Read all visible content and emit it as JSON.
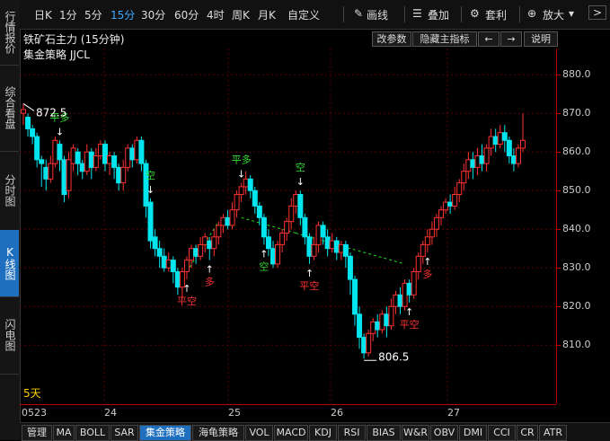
{
  "sidebar": {
    "tabs": [
      {
        "label": "行情报价",
        "active": false
      },
      {
        "label": "综合看盘",
        "active": false
      },
      {
        "label": "分时图",
        "active": false
      },
      {
        "label": "K线图",
        "active": true
      },
      {
        "label": "闪电图",
        "active": false
      }
    ]
  },
  "toolbar": {
    "periods": [
      "日K",
      "1分",
      "5分",
      "15分",
      "30分",
      "60分",
      "4时",
      "周K",
      "月K",
      "自定义"
    ],
    "active_period": "15分",
    "draw_label": "画线",
    "overlay_label": "叠加",
    "arbitrage_label": "套利",
    "zoom_label": "放大",
    "next_label": ">"
  },
  "header": {
    "title": "铁矿石主力 (15分钟)",
    "strategy": "集金策略 JJCL",
    "buttons": [
      "改参数",
      "隐藏主指标",
      "←",
      "→",
      "说明"
    ]
  },
  "price_axis": {
    "ticks": [
      "880.0",
      "870.0",
      "860.0",
      "850.0",
      "840.0",
      "830.0",
      "820.0",
      "810.0"
    ]
  },
  "x_axis": {
    "ticks": [
      "0523",
      "24",
      "25",
      "26",
      "27"
    ]
  },
  "chart_labels": {
    "period_count": "5天",
    "high_label": "872.5",
    "low_label": "806.5"
  },
  "colors": {
    "up": "#ff3030",
    "down": "#00e5ee",
    "signal_green": "#33dd33",
    "signal_red": "#ff3333",
    "dash": "#22dd22"
  },
  "bottom_tabs": [
    "管理",
    "MA",
    "BOLL",
    "SAR",
    "集金策略",
    "海龟策略",
    "VOL",
    "MACD",
    "KDJ",
    "RSI",
    "BIAS",
    "W&R",
    "OBV",
    "DMI",
    "CCI",
    "CR",
    "ATR"
  ],
  "active_bottom_tab": "集金策略",
  "chart_data": {
    "type": "candlestick",
    "title": "铁矿石主力 (15分钟)",
    "ylim": [
      804,
      884
    ],
    "yticks": [
      880,
      870,
      860,
      850,
      840,
      830,
      820,
      810
    ],
    "xticks": [
      "0523",
      "24",
      "25",
      "26",
      "27"
    ],
    "high": 872.5,
    "low": 806.5,
    "candles": [
      [
        870,
        871,
        872.5,
        867
      ],
      [
        869,
        866,
        870,
        864
      ],
      [
        866,
        864,
        867,
        862
      ],
      [
        864,
        858,
        865,
        856
      ],
      [
        858,
        857,
        859,
        851
      ],
      [
        856,
        853,
        858,
        850
      ],
      [
        853,
        857,
        859,
        852
      ],
      [
        857,
        863,
        864,
        856
      ],
      [
        862,
        858,
        863,
        855
      ],
      [
        858,
        849,
        859,
        847
      ],
      [
        850,
        858,
        860,
        848
      ],
      [
        857,
        861,
        862,
        855
      ],
      [
        860,
        857,
        861,
        854
      ],
      [
        857,
        855,
        858,
        853
      ],
      [
        855,
        860,
        862,
        854
      ],
      [
        860,
        856,
        861,
        853
      ],
      [
        856,
        859,
        861,
        855
      ],
      [
        859,
        862,
        863,
        858
      ],
      [
        862,
        857,
        863,
        855
      ],
      [
        857,
        859,
        860,
        854
      ],
      [
        859,
        856,
        860,
        853
      ],
      [
        856,
        852,
        857,
        850
      ],
      [
        852,
        856,
        858,
        850
      ],
      [
        856,
        861,
        862,
        855
      ],
      [
        861,
        858,
        862,
        856
      ],
      [
        858,
        863,
        864,
        857
      ],
      [
        863,
        857,
        864,
        855
      ],
      [
        857,
        846,
        858,
        843
      ],
      [
        847,
        837,
        848,
        835
      ],
      [
        838,
        835,
        840,
        833
      ],
      [
        835,
        833,
        837,
        830
      ],
      [
        833,
        830,
        835,
        829
      ],
      [
        830,
        832,
        834,
        829
      ],
      [
        832,
        829,
        833,
        826
      ],
      [
        829,
        825,
        830,
        823
      ],
      [
        825,
        829,
        830,
        822
      ],
      [
        829,
        832,
        833,
        827
      ],
      [
        832,
        835,
        836,
        830
      ],
      [
        835,
        833,
        836,
        831
      ],
      [
        833,
        836,
        838,
        832
      ],
      [
        836,
        838,
        839,
        834
      ],
      [
        837,
        835,
        838,
        832
      ],
      [
        835,
        838,
        840,
        833
      ],
      [
        838,
        841,
        842,
        836
      ],
      [
        841,
        843,
        844,
        839
      ],
      [
        843,
        841,
        845,
        840
      ],
      [
        841,
        845,
        847,
        840
      ],
      [
        845,
        849,
        850,
        843
      ],
      [
        849,
        851,
        852,
        847
      ],
      [
        851,
        853,
        855,
        849
      ],
      [
        853,
        850,
        854,
        848
      ],
      [
        850,
        846,
        851,
        844
      ],
      [
        846,
        843,
        847,
        841
      ],
      [
        843,
        838,
        844,
        836
      ],
      [
        838,
        835,
        840,
        833
      ],
      [
        835,
        831,
        837,
        830
      ],
      [
        831,
        836,
        837,
        830
      ],
      [
        836,
        839,
        840,
        834
      ],
      [
        839,
        842,
        843,
        837
      ],
      [
        842,
        846,
        848,
        840
      ],
      [
        846,
        849,
        850,
        844
      ],
      [
        849,
        843,
        850,
        841
      ],
      [
        843,
        838,
        844,
        836
      ],
      [
        838,
        833,
        839,
        831
      ],
      [
        833,
        836,
        838,
        832
      ],
      [
        836,
        841,
        842,
        834
      ],
      [
        841,
        838,
        842,
        836
      ],
      [
        838,
        835,
        840,
        833
      ],
      [
        835,
        837,
        839,
        834
      ],
      [
        837,
        834,
        838,
        832
      ],
      [
        834,
        836,
        837,
        832
      ],
      [
        836,
        833,
        837,
        830
      ],
      [
        833,
        827,
        834,
        823
      ],
      [
        827,
        818,
        828,
        815
      ],
      [
        818,
        812,
        820,
        809
      ],
      [
        812,
        808,
        813,
        806.5
      ],
      [
        808,
        813,
        814,
        807
      ],
      [
        813,
        816,
        817,
        811
      ],
      [
        816,
        814,
        818,
        812
      ],
      [
        814,
        818,
        819,
        813
      ],
      [
        818,
        815,
        820,
        812
      ],
      [
        815,
        820,
        822,
        814
      ],
      [
        820,
        823,
        824,
        818
      ],
      [
        823,
        820,
        825,
        818
      ],
      [
        820,
        826,
        827,
        819
      ],
      [
        826,
        823,
        827,
        821
      ],
      [
        823,
        829,
        830,
        822
      ],
      [
        829,
        833,
        834,
        827
      ],
      [
        833,
        836,
        837,
        831
      ],
      [
        836,
        838,
        840,
        834
      ],
      [
        838,
        840,
        842,
        836
      ],
      [
        840,
        843,
        844,
        838
      ],
      [
        843,
        845,
        846,
        841
      ],
      [
        845,
        847,
        848,
        844
      ],
      [
        847,
        846,
        849,
        844
      ],
      [
        846,
        849,
        851,
        845
      ],
      [
        849,
        852,
        853,
        847
      ],
      [
        852,
        855,
        857,
        850
      ],
      [
        855,
        858,
        860,
        853
      ],
      [
        858,
        856,
        860,
        853
      ],
      [
        856,
        859,
        861,
        854
      ],
      [
        859,
        857,
        862,
        855
      ],
      [
        857,
        861,
        862,
        855
      ],
      [
        861,
        864,
        866,
        859
      ],
      [
        864,
        862,
        866,
        860
      ],
      [
        862,
        865,
        867,
        861
      ],
      [
        865,
        863,
        867,
        860
      ],
      [
        863,
        859,
        864,
        857
      ],
      [
        859,
        857,
        861,
        855
      ],
      [
        857,
        861,
        862,
        856
      ],
      [
        861,
        863,
        870,
        860
      ]
    ],
    "signals": [
      {
        "index": 8,
        "label": "平多",
        "color": "green",
        "position": "above"
      },
      {
        "index": 28,
        "label": "空",
        "color": "green",
        "position": "above"
      },
      {
        "index": 36,
        "label": "平空",
        "color": "red",
        "position": "below"
      },
      {
        "index": 41,
        "label": "多",
        "color": "red",
        "position": "below"
      },
      {
        "index": 48,
        "label": "平多",
        "color": "green",
        "position": "above"
      },
      {
        "index": 53,
        "label": "空",
        "color": "green",
        "position": "below"
      },
      {
        "index": 61,
        "label": "空",
        "color": "green",
        "position": "above"
      },
      {
        "index": 63,
        "label": "平空",
        "color": "red",
        "position": "below"
      },
      {
        "index": 85,
        "label": "平空",
        "color": "red",
        "position": "below"
      },
      {
        "index": 89,
        "label": "多",
        "color": "red",
        "position": "below"
      }
    ],
    "dashed_lines": [
      {
        "from": [
          36,
          829
        ],
        "to": [
          43,
          842
        ]
      },
      {
        "from": [
          48,
          843
        ],
        "to": [
          60,
          839
        ]
      },
      {
        "from": [
          60,
          839
        ],
        "to": [
          84,
          831
        ]
      }
    ]
  }
}
